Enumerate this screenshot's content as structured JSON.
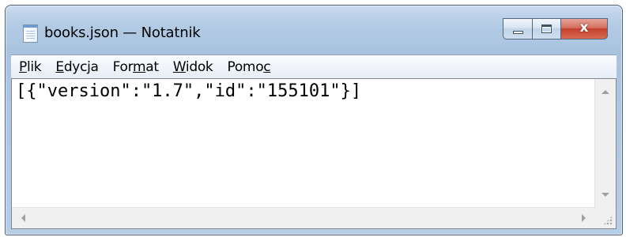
{
  "window": {
    "title": "books.json — Notatnik",
    "close_glyph": "x",
    "icons": {
      "app": "notepad-icon",
      "minimize": "minimize-icon",
      "maximize": "maximize-icon",
      "close": "close-icon"
    }
  },
  "menubar": {
    "items": [
      {
        "pre": "",
        "key": "P",
        "post": "lik"
      },
      {
        "pre": "",
        "key": "E",
        "post": "dycja"
      },
      {
        "pre": "For",
        "key": "m",
        "post": "at"
      },
      {
        "pre": "",
        "key": "W",
        "post": "idok"
      },
      {
        "pre": "Pomo",
        "key": "c",
        "post": ""
      }
    ]
  },
  "editor": {
    "content": "[{\"version\":\"1.7\",\"id\":\"155101\"}]"
  },
  "colors": {
    "titlebar": "#b3cbe4",
    "close_button": "#c3412d",
    "menubar": "#f1f5fa",
    "editor_bg": "#ffffff"
  }
}
